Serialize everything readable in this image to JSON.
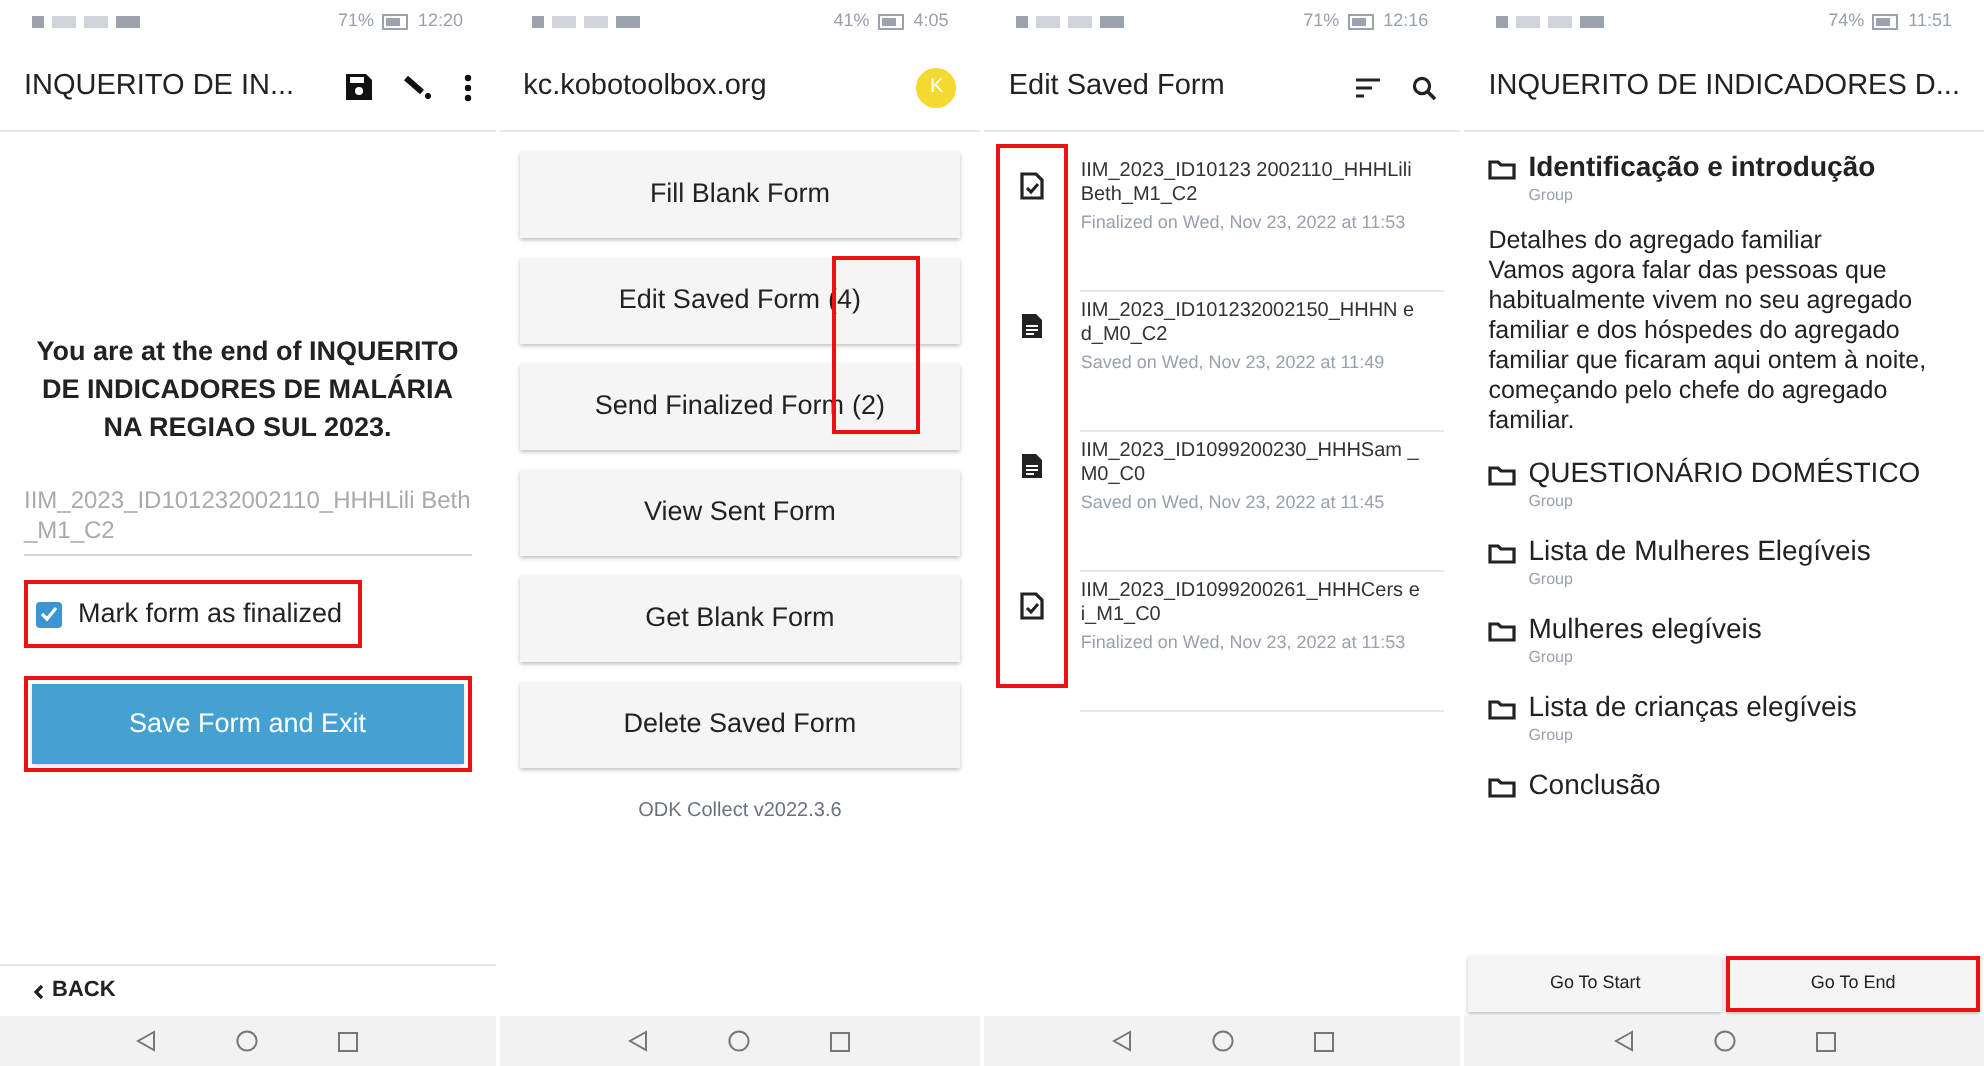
{
  "screens": [
    {
      "status": {
        "battery": "71%",
        "time": "12:20"
      },
      "title": "INQUERITO DE IN...",
      "end_message": "You are at the end of INQUERITO DE INDICADORES DE MALÁRIA NA REGIAO SUL 2023.",
      "instance_name": "IIM_2023_ID101232002110_HHHLili Beth_M1_C2",
      "finalize": {
        "label": "Mark form as finalized",
        "checked": true,
        "highlighted": true
      },
      "save_button": {
        "label": "Save Form and Exit",
        "highlighted": true
      },
      "back": "BACK"
    },
    {
      "status": {
        "battery": "41%",
        "time": "4:05"
      },
      "title": "kc.kobotoolbox.org",
      "avatar": "K",
      "menu": [
        {
          "label": "Fill Blank Form"
        },
        {
          "label": "Edit Saved Form",
          "count": "(4)"
        },
        {
          "label": "Send Finalized Form",
          "count": "(2)"
        },
        {
          "label": "View Sent Form"
        },
        {
          "label": "Get Blank Form"
        },
        {
          "label": "Delete Saved Form"
        }
      ],
      "counts_highlighted": true,
      "version": "ODK Collect v2022.3.6"
    },
    {
      "status": {
        "battery": "71%",
        "time": "12:16"
      },
      "title": "Edit Saved Form",
      "icons_highlighted": true,
      "forms": [
        {
          "kind": "finalized",
          "name": "IIM_2023_ID10123 2002110_HHHLili Beth_M1_C2",
          "detail": "Finalized on Wed, Nov 23, 2022 at 11:53"
        },
        {
          "kind": "saved",
          "name": "IIM_2023_ID101232002150_HHHN ed_M0_C2",
          "detail": "Saved on Wed, Nov 23, 2022 at 11:49"
        },
        {
          "kind": "saved",
          "name": "IIM_2023_ID1099200230_HHHSam _M0_C0",
          "detail": "Saved on Wed, Nov 23, 2022 at 11:45"
        },
        {
          "kind": "finalized",
          "name": "IIM_2023_ID1099200261_HHHCers ei_M1_C0",
          "detail": "Finalized on Wed, Nov 23, 2022 at 11:53"
        }
      ]
    },
    {
      "status": {
        "battery": "74%",
        "time": "11:51"
      },
      "title": "INQUERITO DE INDICADORES D...",
      "groups": [
        {
          "label": "Identificação e introdução",
          "sub": "Group",
          "bold": true
        },
        {
          "kind": "note",
          "heading": "Detalhes do agregado familiar",
          "text": "Vamos agora falar das pessoas que habitualmente vivem no seu agregado familiar e dos hóspedes do agregado familiar que ficaram aqui ontem à noite, começando pelo chefe do agregado familiar."
        },
        {
          "label": "QUESTIONÁRIO DOMÉSTICO",
          "sub": "Group",
          "bold": false
        },
        {
          "label": "Lista de Mulheres Elegíveis",
          "sub": "Group",
          "bold": false
        },
        {
          "label": "Mulheres elegíveis",
          "sub": "Group",
          "bold": false
        },
        {
          "label": "Lista de crianças elegíveis",
          "sub": "Group",
          "bold": false
        },
        {
          "label": "Conclusão",
          "bold": false
        }
      ],
      "nav_buttons": [
        {
          "label": "Go To Start",
          "highlighted": false
        },
        {
          "label": "Go To End",
          "highlighted": true
        }
      ]
    }
  ]
}
